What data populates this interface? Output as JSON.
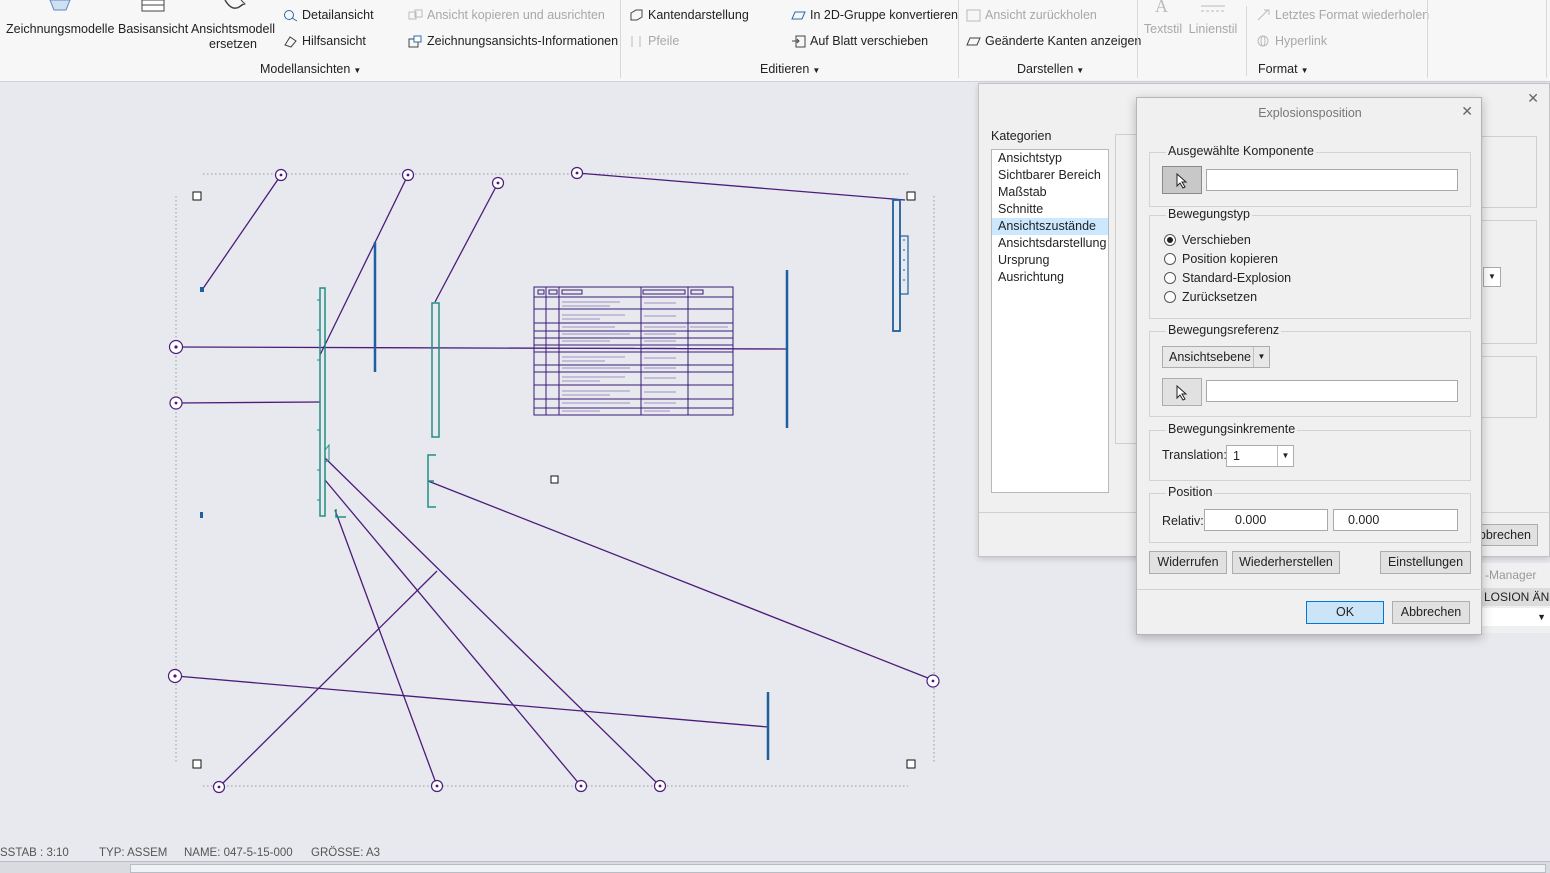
{
  "ribbon": {
    "big_buttons": [
      {
        "label": "Zeichnungsmodelle"
      },
      {
        "label": "Basisansicht"
      },
      {
        "label": "Ansichtsmodell\nersetzen"
      }
    ],
    "model_views": {
      "items": [
        "Detailansicht",
        "Hilfsansicht"
      ],
      "group_label": "Modellansichten"
    },
    "edit": {
      "items": [
        {
          "label": "Ansicht kopieren und ausrichten",
          "disabled": true
        },
        {
          "label": "Zeichnungsansichts-Informationen",
          "disabled": false
        },
        {
          "label": "Kantendarstellung",
          "disabled": false
        },
        {
          "label": "Pfeile",
          "disabled": true
        },
        {
          "label": "In 2D-Gruppe konvertieren",
          "disabled": false
        },
        {
          "label": "Auf Blatt verschieben",
          "disabled": false
        }
      ],
      "group_label": "Editieren"
    },
    "display": {
      "items": [
        {
          "label": "Ansicht zurückholen",
          "disabled": true
        },
        {
          "label": "Geänderte Kanten anzeigen",
          "disabled": false
        }
      ],
      "group_label": "Darstellen"
    },
    "format": {
      "big_items": [
        "Textstil",
        "Linienstil"
      ],
      "items": [
        {
          "label": "Letztes Format wiederholen",
          "disabled": true
        },
        {
          "label": "Hyperlink",
          "disabled": true
        }
      ],
      "group_label": "Format"
    }
  },
  "status": {
    "scale": "SSTAB : 3:10",
    "type": "TYP: ASSEM",
    "name": "NAME: 047-5-15-000",
    "size": "GRÖSSE: A3"
  },
  "background_dialog": {
    "categories_label": "Kategorien",
    "categories": [
      "Ansichtstyp",
      "Sichtbarer Bereich",
      "Maßstab",
      "Schnitte",
      "Ansichtszustände",
      "Ansichtsdarstellung",
      "Ursprung",
      "Ausrichtung"
    ],
    "selected_index": 4,
    "cancel_fragment": "bbrechen",
    "manager_fragment": "-Manager",
    "explosion_fragment": "LOSION ÄND"
  },
  "dialog": {
    "title": "Explosionsposition",
    "selected_component": {
      "legend": "Ausgewählte Komponente",
      "value": ""
    },
    "motion_type": {
      "legend": "Bewegungstyp",
      "options": [
        "Verschieben",
        "Position kopieren",
        "Standard-Explosion",
        "Zurücksetzen"
      ],
      "selected_index": 0
    },
    "motion_reference": {
      "legend": "Bewegungsreferenz",
      "combo_value": "Ansichtsebene",
      "value": ""
    },
    "increments": {
      "legend": "Bewegungsinkremente",
      "translation_label": "Translation:",
      "translation_value": "1"
    },
    "position": {
      "legend": "Position",
      "relative_label": "Relativ:",
      "x": "0.000",
      "y": "0.000"
    },
    "buttons": {
      "undo": "Widerrufen",
      "redo": "Wiederherstellen",
      "settings": "Einstellungen",
      "ok": "OK",
      "cancel": "Abbrechen"
    }
  },
  "colors": {
    "accent": "#0078d7",
    "leader": "#4b1c7a",
    "part_teal": "#1f8f86",
    "part_blue": "#1d5fa0",
    "table_purple": "#3a1a7a"
  }
}
